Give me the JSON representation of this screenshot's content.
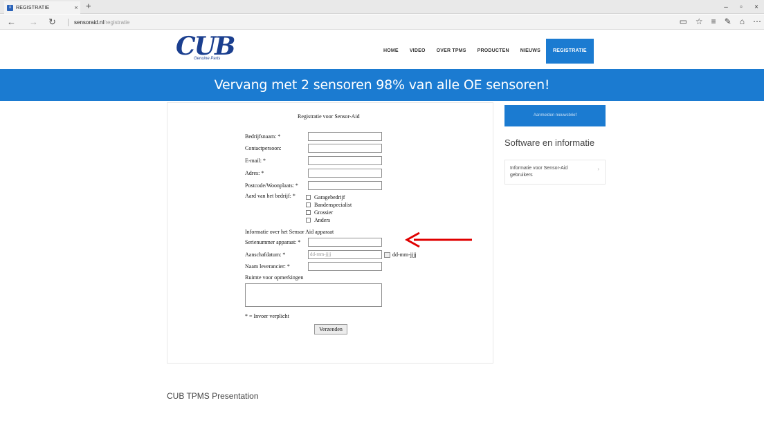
{
  "browser": {
    "tab_title": "REGISTRATIE",
    "tab_close": "×",
    "new_tab": "+",
    "url_host": "sensoraid.nl",
    "url_path": "/registratie",
    "win_min": "–",
    "win_max": "▫",
    "win_close": "×"
  },
  "header": {
    "logo_text": "CUB",
    "logo_sub": "Genuine Parts",
    "nav": [
      {
        "label": "HOME"
      },
      {
        "label": "VIDEO"
      },
      {
        "label": "OVER TPMS"
      },
      {
        "label": "PRODUCTEN"
      },
      {
        "label": "NIEUWS"
      },
      {
        "label": "REGISTRATIE"
      }
    ]
  },
  "banner": {
    "text": "Vervang met 2 sensoren 98% van alle OE sensoren!"
  },
  "form": {
    "title": "Registratie voor Sensor-Aid",
    "fields": {
      "company": "Bedrijfsnaam: *",
      "contact": "Contactpersoon:",
      "email": "E-mail: *",
      "address": "Adres: *",
      "postcode": "Postcode/Woonplaats: *",
      "business_type": "Aard van het bedrijf: *"
    },
    "business_options": [
      "Garagebedrijf",
      "Bandenspecialist",
      "Grossier",
      "Anders"
    ],
    "section_label": "Informatie over het Sensor Aid apparaat",
    "serial": "Serienummer apparaat: *",
    "purchase_date": "Aanschafdatum: *",
    "purchase_date_placeholder": "dd-mm-jjjj",
    "date_format": "dd-mm-jjjj",
    "supplier": "Naam leverancier: *",
    "remarks_label": "Ruimte voor opmerkingen",
    "required_note": "* = Invoer verplicht",
    "submit": "Verzenden"
  },
  "sidebar": {
    "newsletter_button": "Aanmelden nieuwsbrief",
    "heading": "Software en informatie",
    "card_text": "Informatie voor Sensor-Aid gebruikers",
    "card_chevron": "›"
  },
  "footer": {
    "presentation": "CUB TPMS Presentation"
  },
  "colors": {
    "brand_blue": "#1b7bd1",
    "logo_blue": "#1b3f8f",
    "annotation_red": "#e00000"
  }
}
